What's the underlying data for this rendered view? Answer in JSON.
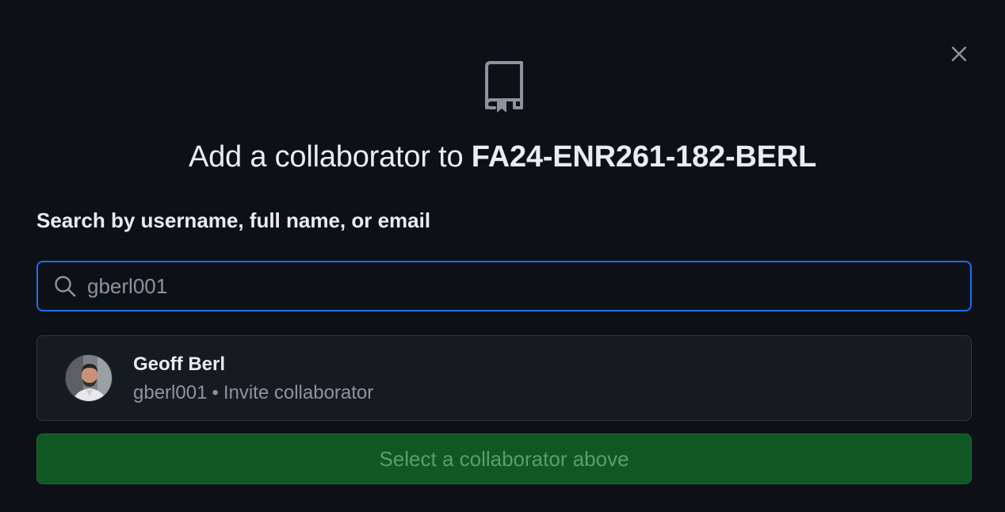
{
  "dialog": {
    "title_prefix": "Add a collaborator to ",
    "repo_name": "FA24-ENR261-182-BERL",
    "close_icon": "close-icon",
    "repo_icon": "repo-icon"
  },
  "search": {
    "label": "Search by username, full name, or email",
    "value": "gberl001",
    "icon": "search-icon"
  },
  "result": {
    "full_name": "Geoff Berl",
    "username": "gberl001",
    "separator": "•",
    "action": "Invite collaborator",
    "avatar": "avatar"
  },
  "submit": {
    "label": "Select a collaborator above"
  },
  "colors": {
    "background": "#0d1117",
    "focus_border": "#1f6feb",
    "button_bg": "#105823",
    "button_text": "#5a9e6a",
    "muted_text": "#8b949e"
  }
}
